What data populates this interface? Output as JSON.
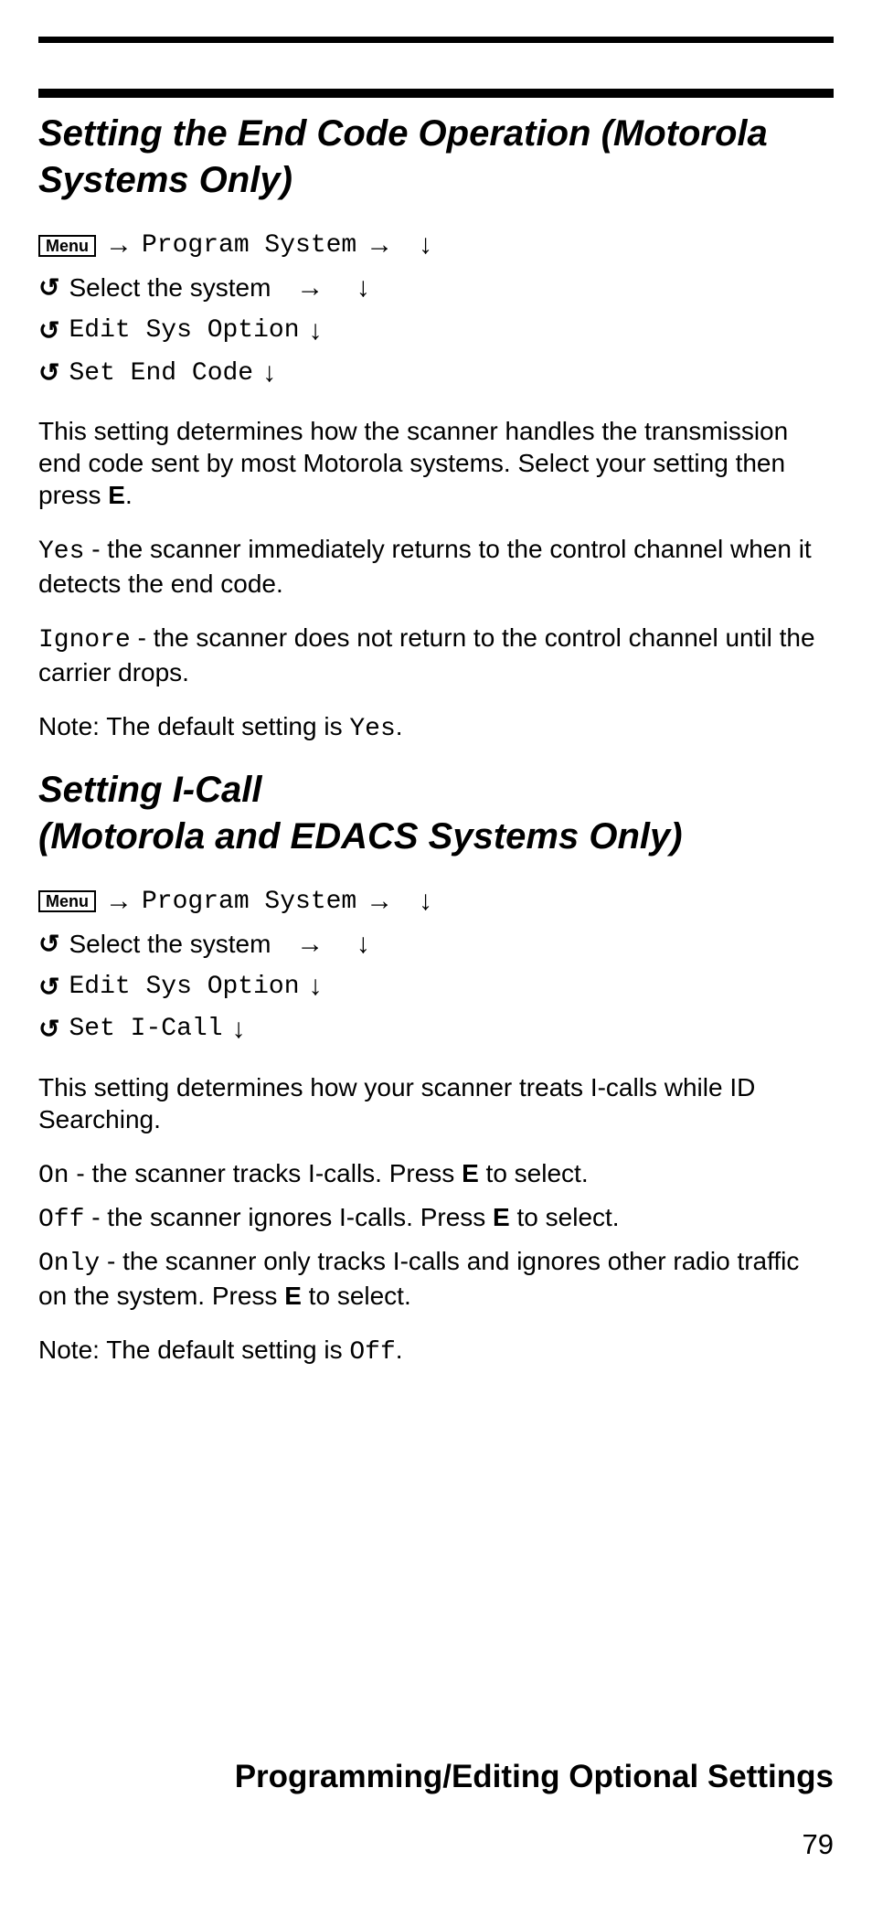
{
  "menuLabel": "Menu",
  "nav": {
    "programSystem": "Program System",
    "selectSystem": "Select the system",
    "editSysOption": "Edit Sys Option"
  },
  "section1": {
    "heading": "Setting the End Code Operation (Motorola Systems Only)",
    "navLast": "Set End Code",
    "intro_a": "This setting determines how the scanner handles the transmission end code sent by most Motorola sys­tems. Select your setting then press ",
    "intro_b_bold": "E",
    "intro_c": ".",
    "yes_code": "Yes",
    "yes_text": " - the scanner immediately returns to the control channel when it detects the end code.",
    "ignore_code": "Ignore",
    "ignore_text": " - the scanner does not return to the control channel until the carrier drops.",
    "note_a": "Note: The default setting is ",
    "note_code": "Yes",
    "note_b": "."
  },
  "section2": {
    "heading_line1": "Setting I-Call",
    "heading_line2": "(Motorola and EDACS Systems Only)",
    "navLast": "Set I-Call",
    "intro": "This setting determines how your scanner treats I-calls while ID Searching.",
    "on_code": "On",
    "on_a": " - the scanner tracks I-calls. Press ",
    "on_bold": "E",
    "on_b": " to select.",
    "off_code": "Off",
    "off_a": " - the scanner ignores I-calls. Press ",
    "off_bold": "E",
    "off_b": " to select.",
    "only_code": "Only",
    "only_a": " - the scanner only tracks I-calls and ignores other radio traffic on the system. Press ",
    "only_bold": "E",
    "only_b": " to select.",
    "note_a": "Note: The default setting is ",
    "note_code": "Off",
    "note_b": "."
  },
  "footer": {
    "title": "Programming/Editing Optional Settings",
    "pageNum": "79"
  }
}
